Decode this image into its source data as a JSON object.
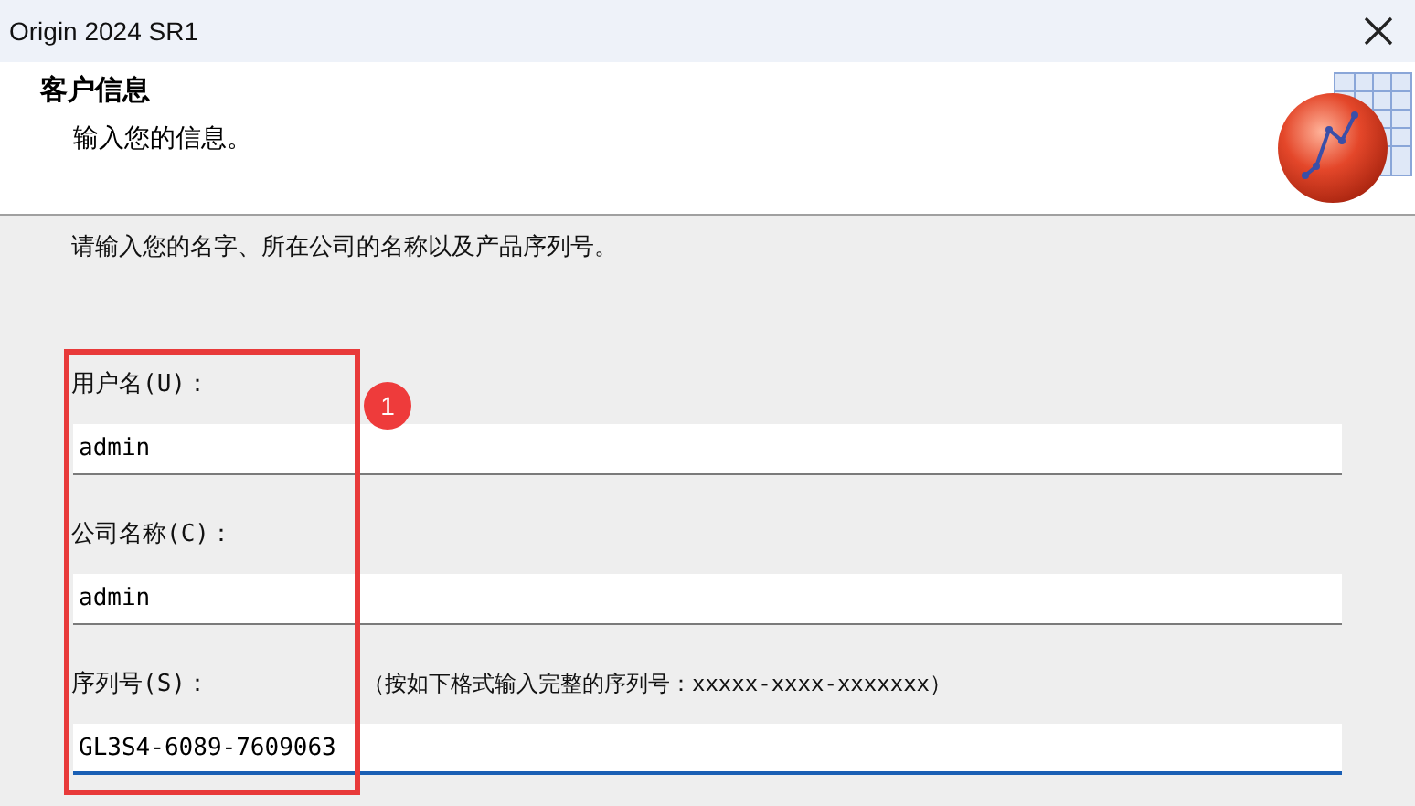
{
  "window": {
    "title": "Origin 2024 SR1"
  },
  "header": {
    "title": "客户信息",
    "subtitle": "输入您的信息。"
  },
  "instruction": "请输入您的名字、所在公司的名称以及产品序列号。",
  "fields": [
    {
      "label": "用户名(U)：",
      "value": "admin",
      "focused": false
    },
    {
      "label": "公司名称(C)：",
      "value": "admin",
      "focused": false
    },
    {
      "label": "序列号(S)：",
      "hint": "（按如下格式输入完整的序列号：xxxxx-xxxx-xxxxxxx）",
      "value": "GL3S4-6089-7609063",
      "focused": true
    }
  ],
  "annotation": {
    "badge": "1"
  }
}
